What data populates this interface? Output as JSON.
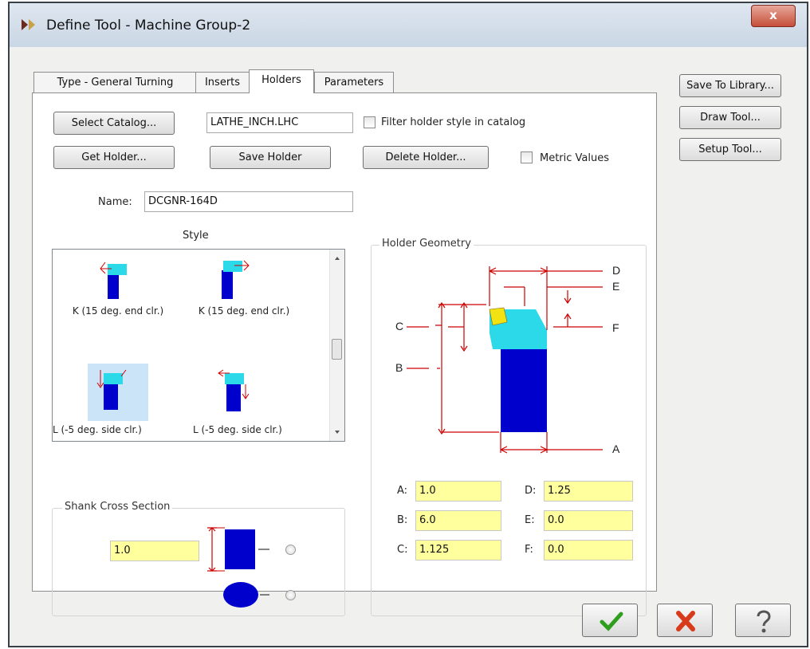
{
  "window": {
    "title": "Define Tool - Machine Group-2",
    "close_label": "x"
  },
  "tabs": [
    "Type - General Turning",
    "Inserts",
    "Holders",
    "Parameters"
  ],
  "active_tab": "Holders",
  "side_buttons": {
    "save_to_library": "Save To Library...",
    "draw_tool": "Draw Tool...",
    "setup_tool": "Setup Tool..."
  },
  "catalog": {
    "select_label": "Select Catalog...",
    "file": "LATHE_INCH.LHC",
    "filter_label": "Filter holder style in catalog",
    "filter_checked": false
  },
  "holder_buttons": {
    "get": "Get Holder...",
    "save": "Save Holder",
    "delete": "Delete Holder...",
    "metric_label": "Metric Values",
    "metric_checked": false
  },
  "name": {
    "label": "Name:",
    "value": "DCGNR-164D"
  },
  "style": {
    "title": "Style",
    "items": [
      {
        "label": "K (15 deg. end clr.)",
        "selected": false
      },
      {
        "label": "K (15 deg. end clr.)",
        "selected": false
      },
      {
        "label": "L (-5 deg. side clr.)",
        "selected": true
      },
      {
        "label": "L (-5 deg. side clr.)",
        "selected": false
      }
    ]
  },
  "shank": {
    "title": "Shank Cross Section",
    "value": "1.0"
  },
  "geometry": {
    "title": "Holder Geometry",
    "diagram_labels": {
      "A": "A",
      "B": "B",
      "C": "C",
      "D": "D",
      "E": "E",
      "F": "F"
    },
    "fields": [
      {
        "label": "A:",
        "value": "1.0"
      },
      {
        "label": "D:",
        "value": "1.25"
      },
      {
        "label": "B:",
        "value": "6.0"
      },
      {
        "label": "E:",
        "value": "0.0"
      },
      {
        "label": "C:",
        "value": "1.125"
      },
      {
        "label": "F:",
        "value": "0.0"
      }
    ]
  },
  "colors": {
    "accent_blue": "#0000cc",
    "cyan": "#2bd9e8",
    "insert_yellow": "#f3e211",
    "dim_red": "#cc0000",
    "field_yellow": "#ffff9e"
  },
  "icons": {
    "ok": "checkmark-icon",
    "cancel": "x-icon",
    "help": "question-icon"
  }
}
